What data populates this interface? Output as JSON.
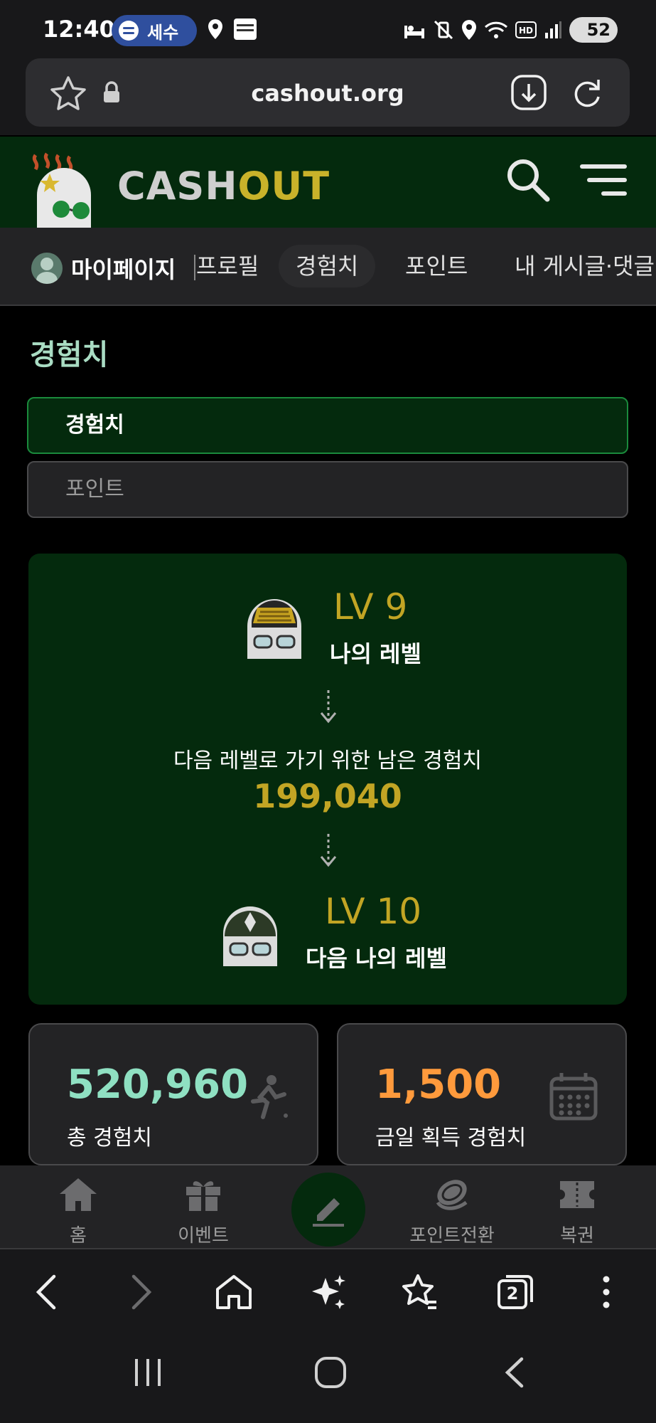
{
  "status_bar": {
    "time": "12:40",
    "spotify_label": "세수",
    "battery": "52",
    "icons": [
      "spotify-icon",
      "location-icon",
      "timeway-manager-icon",
      "bed-icon",
      "vibrate-off-icon",
      "location-icon",
      "wifi-icon",
      "hd-icon",
      "signal-icon",
      "battery-icon"
    ]
  },
  "browser": {
    "url": "cashout.org",
    "toolbar": [
      "back-icon",
      "forward-icon",
      "home-icon",
      "ai-sparkle-icon",
      "bookmarks-icon",
      "tabs-icon",
      "more-icon"
    ],
    "tab_count": "2"
  },
  "site": {
    "logo_cash": "CASH",
    "logo_out": "OUT",
    "colors": {
      "header_bg": "#042a0d",
      "accent_gold": "#c2a524",
      "accent_mint": "#8fe0c2",
      "accent_orange": "#ff9a3c"
    }
  },
  "sub_nav": {
    "title": "마이페이지",
    "tabs": [
      {
        "label": "프로필",
        "active": false
      },
      {
        "label": "경험치",
        "active": true
      },
      {
        "label": "포인트",
        "active": false
      },
      {
        "label": "내 게시글·댓글",
        "active": false
      }
    ]
  },
  "page": {
    "title": "경험치",
    "tab_experience": "경험치",
    "tab_points": "포인트"
  },
  "level_card": {
    "current_level": "LV 9",
    "current_level_label": "나의 레벨",
    "remaining_label": "다음 레벨로 가기 위한 남은 경험치",
    "remaining_value": "199,040",
    "next_level": "LV 10",
    "next_level_label": "다음 나의 레벨"
  },
  "stats": {
    "total_value": "520,960",
    "total_label": "총 경험치",
    "today_value": "1,500",
    "today_label": "금일 획득 경험치"
  },
  "app_nav": {
    "home": "홈",
    "event": "이벤트",
    "point_convert": "포인트전환",
    "lottery": "복권"
  }
}
